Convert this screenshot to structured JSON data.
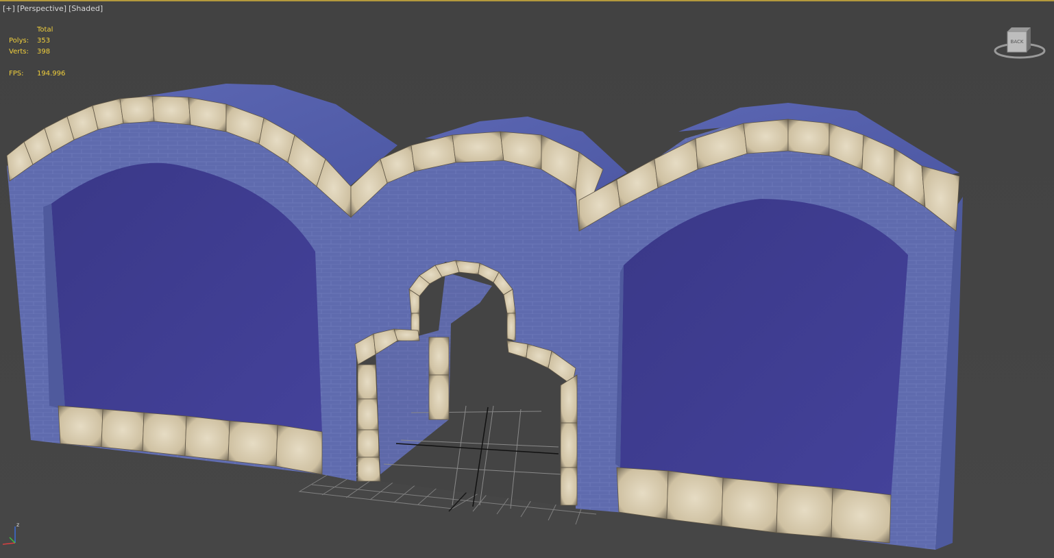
{
  "viewport": {
    "menu_plus": "[+]",
    "view_mode": "[Perspective]",
    "shading_mode": "[Shaded]"
  },
  "stats": {
    "header": "Total",
    "polys_label": "Polys:",
    "polys_value": "353",
    "verts_label": "Verts:",
    "verts_value": "398",
    "fps_label": "FPS:",
    "fps_value": "194.996"
  },
  "viewcube": {
    "face_label": "BACK"
  },
  "axis": {
    "z_label": "z"
  },
  "colors": {
    "viewport_border": "#b49a3c",
    "stats_text": "#f2d03c",
    "wall_blue": "#5e6aad",
    "panel_purple": "#3c3a8c",
    "stone_trim": "#d8cbb0"
  }
}
